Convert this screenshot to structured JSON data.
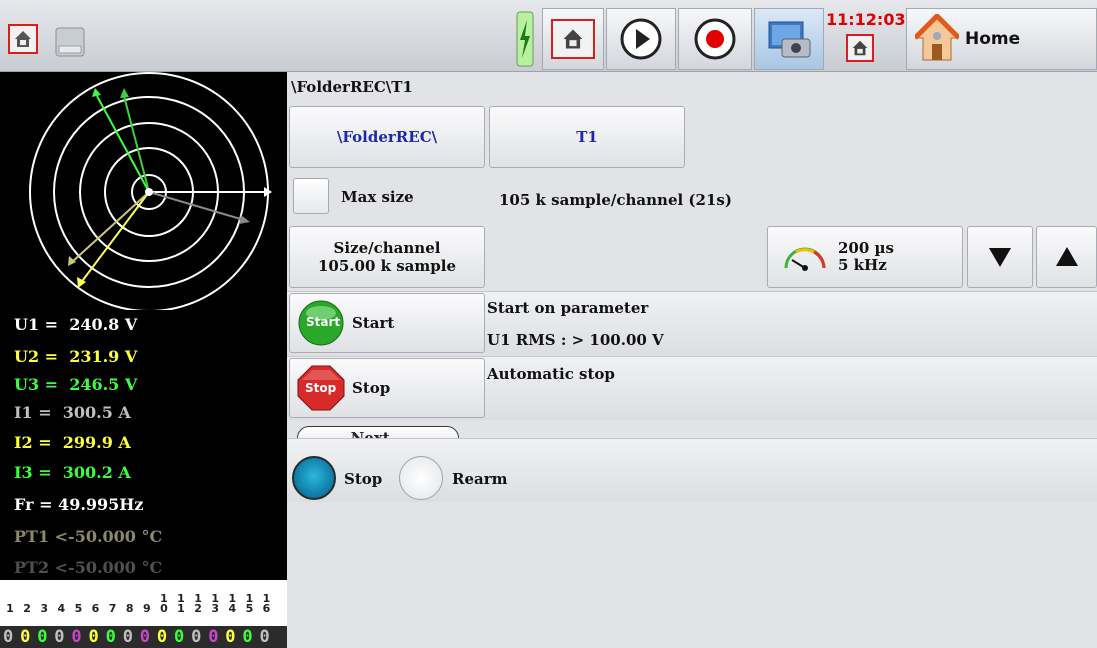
{
  "toolbar": {
    "clock": "11:12:03",
    "home_label": "Home",
    "buttons": [
      "home",
      "disk",
      "power",
      "home-boxed",
      "play",
      "record",
      "screenshot",
      "home"
    ]
  },
  "measurements": [
    {
      "label": "U1 =  240.8 V",
      "color": "#ffffff"
    },
    {
      "label": "U2 =  231.9 V",
      "color": "#ffff3c"
    },
    {
      "label": "U3 =  246.5 V",
      "color": "#3cff3c"
    },
    {
      "label": "I1 =  300.5 A",
      "color": "#c0c0c0"
    },
    {
      "label": "I2 =  299.9 A",
      "color": "#ffff3c"
    },
    {
      "label": "I3 =  300.2 A",
      "color": "#3cff3c"
    },
    {
      "label": "Fr = 49.995Hz",
      "color": "#ffffff"
    },
    {
      "label": "PT1 <-50.000 °C",
      "color": "#8a8a6a"
    },
    {
      "label": "PT2 <-50.000 °C",
      "color": "#505050"
    }
  ],
  "channels": {
    "numbers": [
      "1",
      "2",
      "3",
      "4",
      "5",
      "6",
      "7",
      "8",
      "9",
      "10",
      "11",
      "12",
      "13",
      "14",
      "15",
      "16"
    ],
    "digits": [
      "0",
      "0",
      "0",
      "0",
      "0",
      "0",
      "0",
      "0",
      "0",
      "0",
      "0",
      "0",
      "0",
      "0",
      "0",
      "0"
    ],
    "digit_colors": [
      "#c0c0c0",
      "#ffff3c",
      "#3cff3c",
      "#c0c0c0",
      "#cc44cc",
      "#ffff3c",
      "#3cff3c",
      "#c0c0c0",
      "#cc44cc",
      "#ffff3c",
      "#3cff3c",
      "#c0c0c0",
      "#cc44cc",
      "#ffff3c",
      "#3cff3c",
      "#c0c0c0"
    ]
  },
  "main": {
    "path": "\\FolderREC\\T1",
    "folder_button": "\\FolderREC\\",
    "file_button": "T1",
    "max_size_label": "Max size",
    "sample_info": "105 k sample/channel (21s)",
    "size_button_line1": "Size/channel",
    "size_button_line2": "105.00  k sample",
    "rate_line1": "200 µs",
    "rate_line2": "5 kHz",
    "start_label": "Start",
    "start_icon_text": "Start",
    "start_desc1": "Start on parameter",
    "start_desc2": "U1 RMS : > 100.00 V",
    "stop_label": "Stop",
    "stop_icon_text": "Stop",
    "stop_desc": "Automatic stop",
    "next_label": "Next...",
    "radio_stop": "Stop",
    "radio_rearm": "Rearm"
  }
}
